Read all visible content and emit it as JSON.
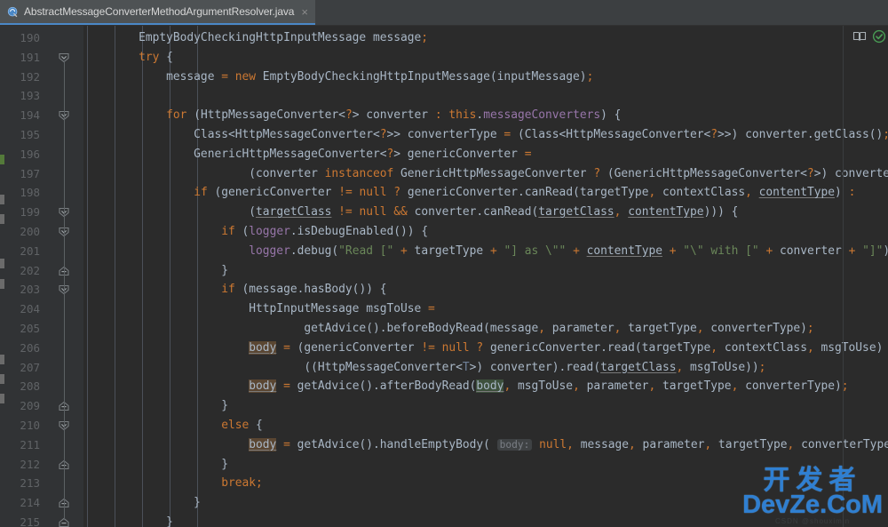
{
  "tab": {
    "title": "AbstractMessageConverterMethodArgumentResolver.java",
    "icon": "java-class-icon",
    "close_label": "×",
    "accent_color": "#4a88c7"
  },
  "editor": {
    "theme": "darcula",
    "background": "#2b2b2b",
    "gutter_background": "#313335",
    "first_line": 190,
    "last_line": 215,
    "line_numbers": [
      190,
      191,
      192,
      193,
      194,
      195,
      196,
      197,
      198,
      199,
      200,
      201,
      202,
      203,
      204,
      205,
      206,
      207,
      208,
      209,
      210,
      211,
      212,
      213,
      214,
      215
    ],
    "fold_markers": [
      {
        "line": 191,
        "type": "chevron-down"
      },
      {
        "line": 194,
        "type": "chevron-down"
      },
      {
        "line": 199,
        "type": "chevron-down"
      },
      {
        "line": 200,
        "type": "chevron-down"
      },
      {
        "line": 202,
        "type": "fold-end"
      },
      {
        "line": 203,
        "type": "chevron-down"
      },
      {
        "line": 209,
        "type": "fold-end"
      },
      {
        "line": 210,
        "type": "chevron-down"
      },
      {
        "line": 212,
        "type": "fold-end"
      },
      {
        "line": 214,
        "type": "fold-end"
      },
      {
        "line": 215,
        "type": "fold-end"
      }
    ],
    "colors": {
      "keyword": "#cc7832",
      "string": "#6a8759",
      "number": "#6897bb",
      "field": "#9876aa",
      "text": "#a9b7c6",
      "comment": "#808080",
      "type_param": "#6f8098",
      "hint_chip_bg": "#3f4244",
      "hint_chip_fg": "#7a7e85",
      "write_highlight": "#5a4632",
      "read_highlight": "#3d503c",
      "line_number": "#606366"
    },
    "lines": [
      {
        "n": 190,
        "text": "        EmptyBodyCheckingHttpInputMessage message;"
      },
      {
        "n": 191,
        "text": "        try {"
      },
      {
        "n": 192,
        "text": "            message = new EmptyBodyCheckingHttpInputMessage(inputMessage);"
      },
      {
        "n": 193,
        "text": ""
      },
      {
        "n": 194,
        "text": "            for (HttpMessageConverter<?> converter : this.messageConverters) {"
      },
      {
        "n": 195,
        "text": "                Class<HttpMessageConverter<?>> converterType = (Class<HttpMessageConverter<?>>) converter.getClass();"
      },
      {
        "n": 196,
        "text": "                GenericHttpMessageConverter<?> genericConverter ="
      },
      {
        "n": 197,
        "text": "                        (converter instanceof GenericHttpMessageConverter ? (GenericHttpMessageConverter<?>) converter : null);"
      },
      {
        "n": 198,
        "text": "                if (genericConverter != null ? genericConverter.canRead(targetType, contextClass, contentType) :"
      },
      {
        "n": 199,
        "text": "                        (targetClass != null && converter.canRead(targetClass, contentType))) {"
      },
      {
        "n": 200,
        "text": "                    if (logger.isDebugEnabled()) {"
      },
      {
        "n": 201,
        "text": "                        logger.debug(\"Read [\" + targetType + \"] as \\\"\" + contentType + \"\\\" with [\" + converter + \"]\");"
      },
      {
        "n": 202,
        "text": "                    }"
      },
      {
        "n": 203,
        "text": "                    if (message.hasBody()) {"
      },
      {
        "n": 204,
        "text": "                        HttpInputMessage msgToUse ="
      },
      {
        "n": 205,
        "text": "                                getAdvice().beforeBodyRead(message, parameter, targetType, converterType);"
      },
      {
        "n": 206,
        "text": "                        body = (genericConverter != null ? genericConverter.read(targetType, contextClass, msgToUse) :"
      },
      {
        "n": 207,
        "text": "                                ((HttpMessageConverter<T>) converter).read(targetClass, msgToUse));"
      },
      {
        "n": 208,
        "text": "                        body = getAdvice().afterBodyRead(body, msgToUse, parameter, targetType, converterType);"
      },
      {
        "n": 209,
        "text": "                    }"
      },
      {
        "n": 210,
        "text": "                    else {"
      },
      {
        "n": 211,
        "text": "                        body = getAdvice().handleEmptyBody( body: null, message, parameter, targetType, converterType);"
      },
      {
        "n": 212,
        "text": "                    }"
      },
      {
        "n": 213,
        "text": "                    break;"
      },
      {
        "n": 214,
        "text": "                }"
      },
      {
        "n": 215,
        "text": "            }"
      }
    ],
    "inlay_hints": [
      {
        "line": 211,
        "label": "body:"
      }
    ],
    "highlighted_identifier": "body"
  },
  "right_rail": {
    "icons": [
      {
        "name": "reader-mode-icon",
        "label": "Reader mode"
      },
      {
        "name": "inspections-ok-icon",
        "label": "No problems found",
        "color": "#499c54"
      }
    ]
  },
  "watermark": {
    "cn": "开发者",
    "en": "DevZe.CoM",
    "sub": "CSDN @shouximin",
    "color": "#2f7fd1"
  }
}
